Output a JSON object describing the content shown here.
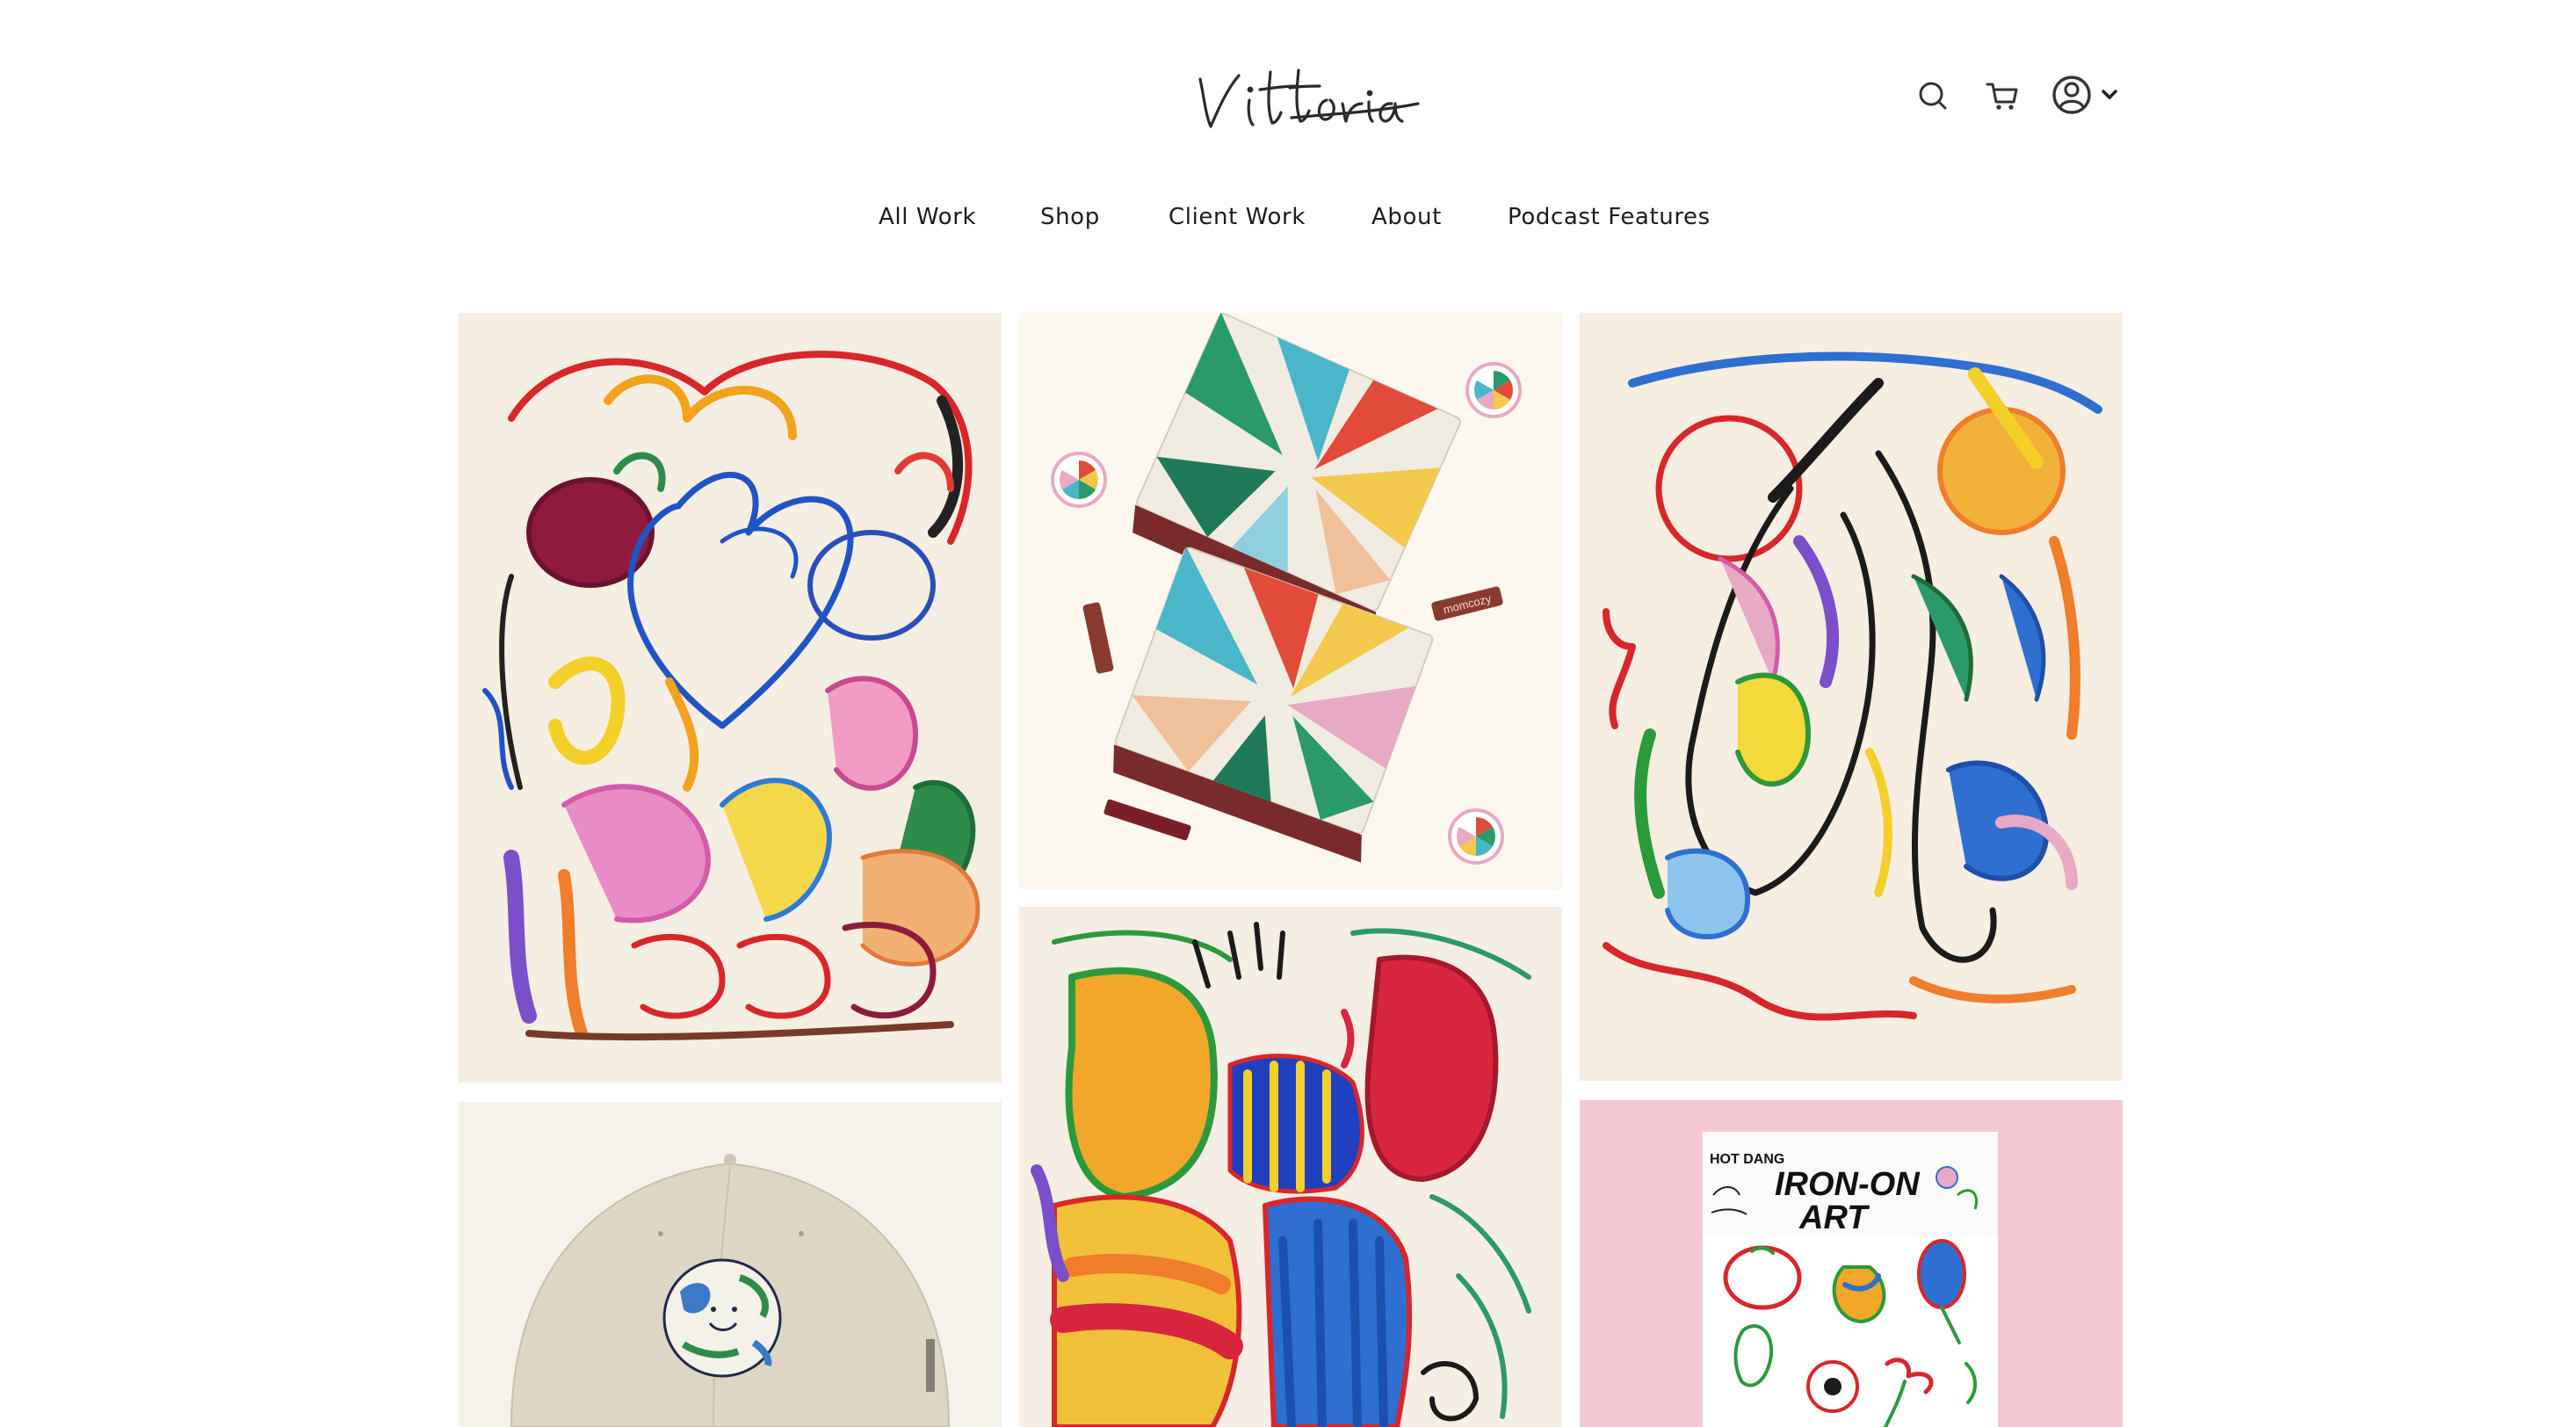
{
  "brand": {
    "logo_text": "Vittoria"
  },
  "header": {
    "icons": [
      "search-icon",
      "cart-icon",
      "account-icon",
      "chevron-down-icon"
    ]
  },
  "nav": {
    "items": [
      {
        "label": "All Work"
      },
      {
        "label": "Shop"
      },
      {
        "label": "Client Work"
      },
      {
        "label": "About"
      },
      {
        "label": "Podcast Features"
      }
    ]
  },
  "gallery": {
    "tiles": [
      {
        "name": "crayon-heart-artwork",
        "background": "#f5eee2"
      },
      {
        "name": "momcozy-packaging-artwork",
        "background": "#fcf8ef",
        "brand_text": "momcozy"
      },
      {
        "name": "crayon-abstract-figure-artwork",
        "background": "#f5eee1"
      },
      {
        "name": "earth-cap-product",
        "background": "#f5f2ec"
      },
      {
        "name": "crayon-fruit-drawing-artwork",
        "background": "#f5eee4"
      },
      {
        "name": "iron-on-art-product",
        "background": "#f4c8d3",
        "package_brand": "HOT DANG",
        "package_title_line1": "IRON-ON",
        "package_title_line2": "ART"
      }
    ]
  },
  "colors": {
    "text": "#1c1c1c",
    "background": "#ffffff",
    "pink": "#f4c8d3"
  }
}
